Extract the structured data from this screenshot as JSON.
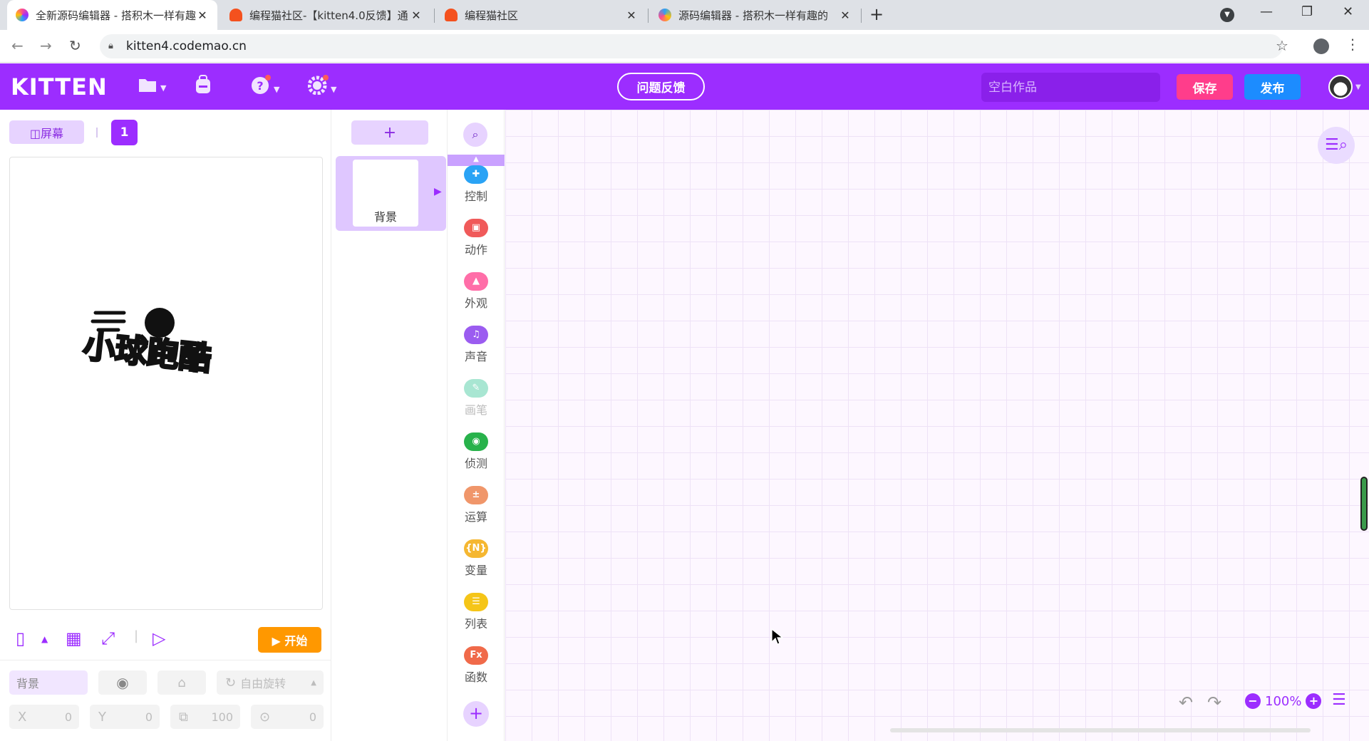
{
  "browser": {
    "tabs": [
      {
        "title": "全新源码编辑器 - 搭积木一样有趣",
        "close": "✕",
        "active": true
      },
      {
        "title": "编程猫社区-【kitten4.0反馈】通",
        "close": "✕",
        "active": false
      },
      {
        "title": "编程猫社区",
        "close": "✕",
        "active": false
      },
      {
        "title": "源码编辑器 - 搭积木一样有趣的",
        "close": "✕",
        "active": false
      }
    ],
    "new_tab": "+",
    "url": "kitten4.codemao.cn",
    "window": {
      "minimize": "—",
      "restore": "❐",
      "close": "✕"
    }
  },
  "header": {
    "logo": "KITTEN",
    "feedback_label": "问题反馈",
    "work_placeholder": "空白作品",
    "save_label": "保存",
    "publish_label": "发布"
  },
  "stage": {
    "screen_label": "屏幕",
    "screen_number": "1",
    "start_label": "开始",
    "logo_text": "小球跑酷"
  },
  "props": {
    "name": "背景",
    "rotation_label": "自由旋转",
    "x_label": "X",
    "x_value": "0",
    "y_label": "Y",
    "y_value": "0",
    "size_value": "100",
    "direction_value": "0"
  },
  "sprites": {
    "add_label": "+",
    "items": [
      {
        "label": "背景"
      }
    ]
  },
  "categories": [
    {
      "name": "控制",
      "color": "#2aa3f5",
      "glyph": "✚"
    },
    {
      "name": "动作",
      "color": "#f05a5a",
      "glyph": "▣"
    },
    {
      "name": "外观",
      "color": "#ff6ea8",
      "glyph": "▲"
    },
    {
      "name": "声音",
      "color": "#9b5cf0",
      "glyph": "♫"
    },
    {
      "name": "画笔",
      "color": "#a8e6d2",
      "glyph": "✎"
    },
    {
      "name": "侦测",
      "color": "#28b24b",
      "glyph": "◉"
    },
    {
      "name": "运算",
      "color": "#f0966a",
      "glyph": "±"
    },
    {
      "name": "变量",
      "color": "#f5b731",
      "glyph": "{N}"
    },
    {
      "name": "列表",
      "color": "#f5c518",
      "glyph": "☰"
    },
    {
      "name": "函数",
      "color": "#f06a4a",
      "glyph": "Fx"
    }
  ],
  "workspace": {
    "zoom": "100%",
    "zoom_out": "−",
    "zoom_in": "+"
  }
}
